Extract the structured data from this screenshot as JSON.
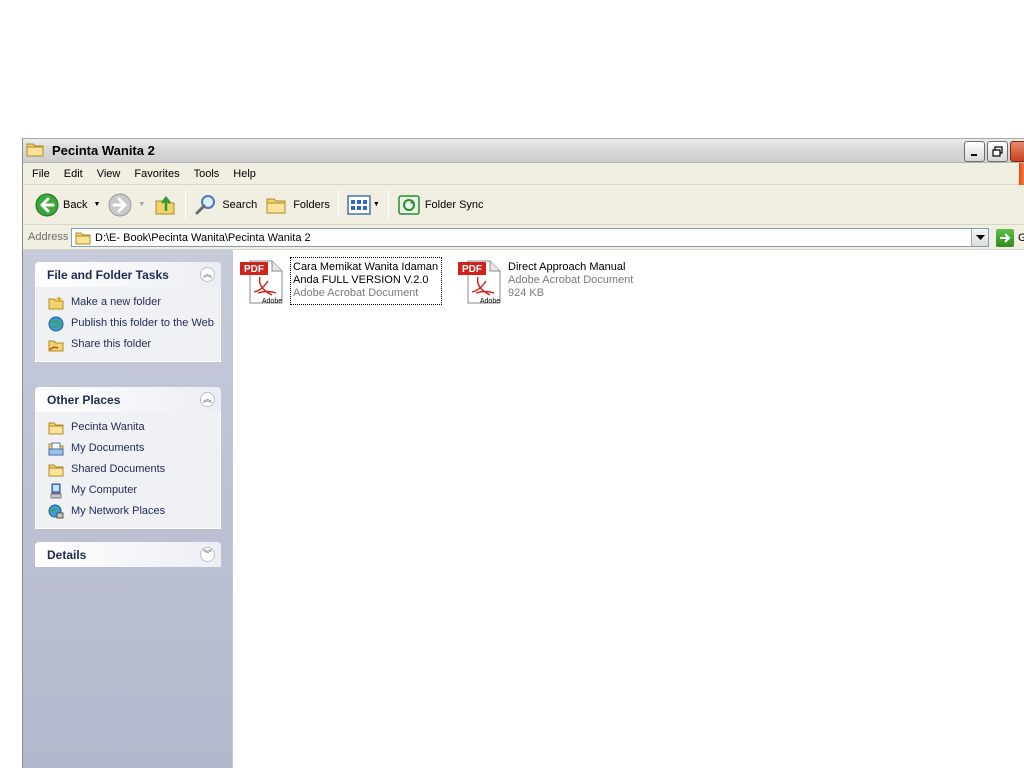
{
  "window": {
    "title": "Pecinta Wanita 2",
    "title_icon": "folder-icon"
  },
  "menu": {
    "items": [
      "File",
      "Edit",
      "View",
      "Favorites",
      "Tools",
      "Help"
    ]
  },
  "toolbar": {
    "back_label": "Back",
    "search_label": "Search",
    "folders_label": "Folders",
    "folder_sync_label": "Folder Sync"
  },
  "address": {
    "label": "Address",
    "path": "D:\\E- Book\\Pecinta Wanita\\Pecinta Wanita 2",
    "go_label": "G"
  },
  "tasks": {
    "file_folder": {
      "title": "File and Folder Tasks",
      "items": [
        "Make a new folder",
        "Publish this folder to the Web",
        "Share this folder"
      ]
    },
    "other_places": {
      "title": "Other Places",
      "items": [
        "Pecinta Wanita",
        "My Documents",
        "Shared Documents",
        "My Computer",
        "My Network Places"
      ]
    },
    "details": {
      "title": "Details"
    }
  },
  "files": [
    {
      "name_line1": "Cara Memikat Wanita Idaman",
      "name_line2": "Anda FULL VERSION V.2.0",
      "type": "Adobe Acrobat Document",
      "size": "",
      "icon": "pdf-icon"
    },
    {
      "name_line1": "Direct Approach Manual",
      "name_line2": "",
      "type": "Adobe Acrobat Document",
      "size": "924 KB",
      "icon": "pdf-icon"
    }
  ],
  "icon_labels": {
    "pdf_badge": "PDF",
    "adobe_text": "Adobe"
  },
  "colors": {
    "accent": "#2d5fb8",
    "pdf_red": "#d0231b",
    "task_pane": "#b3b8cc"
  }
}
